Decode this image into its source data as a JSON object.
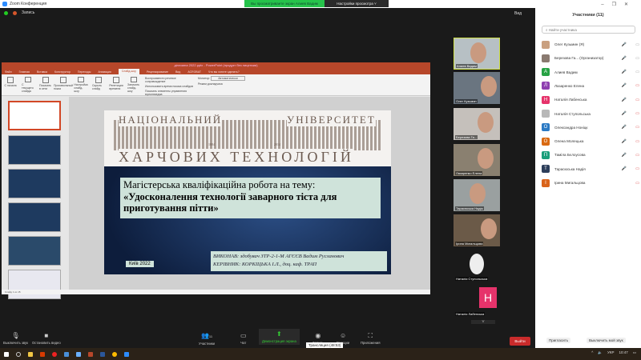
{
  "window": {
    "title": "Zoom Конференция",
    "banner": "Вы просматриваете экран Алиев Вадим",
    "view_options": "Настройки просмотра ˅",
    "recording": "Запись",
    "view": "Вид"
  },
  "ppt": {
    "title": "діпломна 2022.pptx - PowerPoint (продукт без лицензии)",
    "tabs": [
      "Файл",
      "Главная",
      "Вставка",
      "Конструктор",
      "Переходы",
      "Анимация",
      "Слайд-шоу",
      "Рецензирование",
      "Вид",
      "ACROBAT",
      "Что вы хотите сделать?"
    ],
    "active_tab": "Слайд-шоу",
    "ribbon": [
      "С начала",
      "С текущего слайда",
      "Показать в сети",
      "Произвольный показ",
      "Настройка слайд-шоу",
      "Скрыть слайд",
      "Репетиция времени",
      "Записать слайд-шоу"
    ],
    "checks": [
      "Воспроизвести речевое сопровождение",
      "Использовать время показа слайдов",
      "Показать элементы управления мультимедиа"
    ],
    "monitor_label": "Монитор:",
    "monitor_value": "Автоматически",
    "presenter": "Режим докладчика",
    "status": "Слайд 1 из 15"
  },
  "slide": {
    "uni_top_left": "НАЦІОНАЛЬНИЙ",
    "uni_top_right": "УНІВЕРСИТЕТ",
    "uni_bottom": "ХАРЧОВИХ ТЕХНОЛОГІЙ",
    "year_left": "1884",
    "year_right": "2014",
    "line1": "Магістерська кваліфікаційна робота на тему:",
    "line2": "«Удосконалення технології заварного тіста для приготування пітти»",
    "author": "ВИКОНАВ: здобувач ЗТР-2-1-М АГЄЄВ Вадим Русланович",
    "supervisor": "КЕРІВНИК: КОРКІЦЬКА І.Л., доц. каф. ТРАП",
    "city_year": "Київ 2022"
  },
  "tiles": [
    "Алиев Вадим",
    "Олег Кузьмин",
    "Березова Га...",
    "Лазаренко Елена",
    "Тарасюська Надія",
    "Ірина Мигальцова",
    "Наталія Ступольська",
    "Наталія Лабенська"
  ],
  "panel": {
    "title": "Участники (11)",
    "search_placeholder": "Найти участника",
    "invite": "Пригласить",
    "mute_me": "Выключить мой звук",
    "participants": [
      {
        "name": "Олег Кузьмин (Я)",
        "initial": "",
        "color": "#c9a080"
      },
      {
        "name": "Березова Га... (Организатор)",
        "initial": "",
        "color": "#8a7a70"
      },
      {
        "name": "Алиев Вадим",
        "initial": "А",
        "color": "#27a244"
      },
      {
        "name": "Лазаренко Елена",
        "initial": "Л",
        "color": "#8e3fb0"
      },
      {
        "name": "Наталія Лабенська",
        "initial": "Н",
        "color": "#e6336b"
      },
      {
        "name": "Наталія Ступольська",
        "initial": "",
        "color": "#b8b8b8"
      },
      {
        "name": "Олександра Ноніцк",
        "initial": "О",
        "color": "#2b7ac4"
      },
      {
        "name": "Олена Молецька",
        "initial": "О",
        "color": "#d96a12"
      },
      {
        "name": "Таміла Бєлоусова",
        "initial": "П",
        "color": "#1a9e7a"
      },
      {
        "name": "Тарасюська Надія",
        "initial": "Т",
        "color": "#2c3e5a"
      },
      {
        "name": "Ірина Мигальцова",
        "initial": "І",
        "color": "#d9641a"
      }
    ]
  },
  "toolbar": {
    "mute": "Выключить звук",
    "video": "Остановить видео",
    "participants": "Участники",
    "participants_count": "11",
    "chat": "Чат",
    "share": "Демонстрация экрана",
    "record": "Запись",
    "reactions": "Реакции",
    "apps": "Приложения",
    "tooltip": "Трансляция (48:53)",
    "leave": "Выйти"
  },
  "tray": {
    "lang": "УКР",
    "time": "10:47"
  }
}
